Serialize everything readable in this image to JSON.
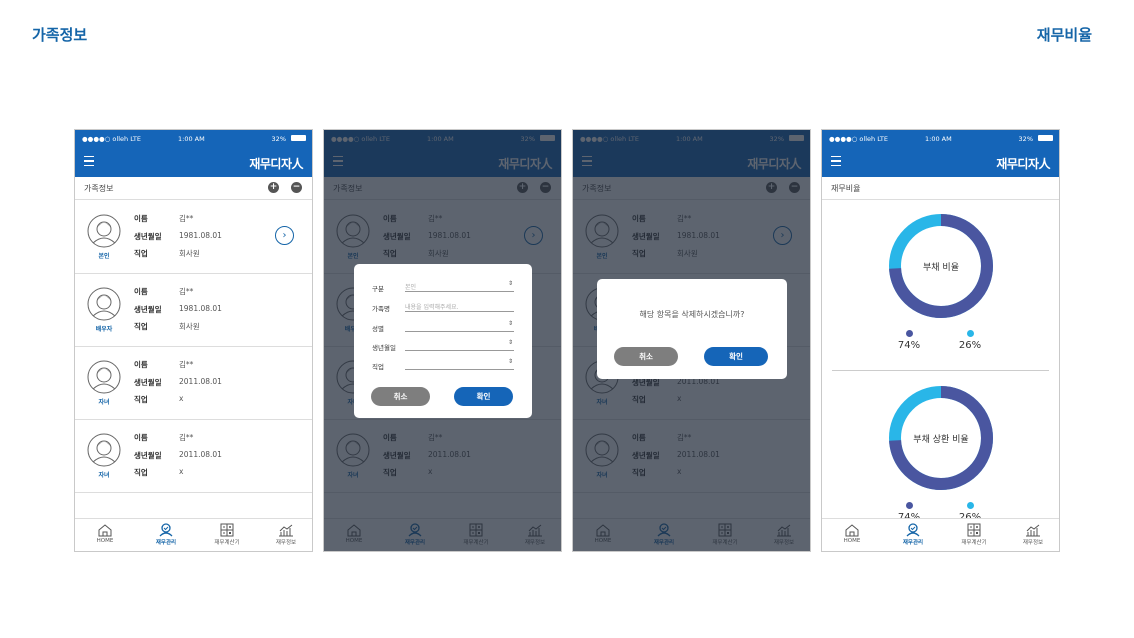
{
  "page": {
    "title_left": "가족정보",
    "title_right": "재무비율"
  },
  "status_bar": {
    "carrier": "●●●●○ olleh LTE",
    "time": "1:00 AM",
    "battery": "32%"
  },
  "app": {
    "logo": "재무디자人",
    "menu_icon": "hamburger-menu-icon"
  },
  "family_screen": {
    "header_label": "가족정보",
    "add_icon": "+",
    "remove_icon": "−",
    "field_labels": {
      "name": "이름",
      "birth": "생년월일",
      "job": "직업"
    },
    "members": [
      {
        "role": "본인",
        "name": "김**",
        "birth": "1981.08.01",
        "job": "회사원",
        "has_detail": true
      },
      {
        "role": "배우자",
        "name": "김**",
        "birth": "1981.08.01",
        "job": "회사원"
      },
      {
        "role": "자녀",
        "name": "김**",
        "birth": "2011.08.01",
        "job": "x"
      },
      {
        "role": "자녀",
        "name": "김**",
        "birth": "2011.08.01",
        "job": "x"
      }
    ],
    "detail_icon": "›"
  },
  "tabs": [
    {
      "label": "HOME",
      "icon": "home-icon"
    },
    {
      "label": "재무관리",
      "icon": "finance-manage-icon",
      "active": true
    },
    {
      "label": "재무계산기",
      "icon": "calculator-icon"
    },
    {
      "label": "재무정보",
      "icon": "finance-info-icon"
    }
  ],
  "form_dialog": {
    "fields": [
      {
        "label": "구분",
        "value": "본인",
        "select": true
      },
      {
        "label": "가족명",
        "placeholder": "내용을 입력해주세요.",
        "select": false
      },
      {
        "label": "성별",
        "value": "",
        "select": true
      },
      {
        "label": "생년월일",
        "value": "",
        "select": true
      },
      {
        "label": "직업",
        "value": "",
        "select": true
      }
    ],
    "cancel_label": "취소",
    "ok_label": "확인",
    "select_icon": "⇕"
  },
  "confirm_dialog": {
    "message": "해당 항목을 삭제하시겠습니까?",
    "cancel_label": "취소",
    "ok_label": "확인"
  },
  "ratio_screen": {
    "header_label": "재무비율",
    "charts": [
      {
        "title": "부채 비율",
        "slices": [
          74,
          26
        ],
        "labels": [
          "74%",
          "26%"
        ]
      },
      {
        "title": "부채 상환 비율",
        "slices": [
          74,
          26
        ],
        "labels": [
          "74%",
          "26%"
        ]
      }
    ],
    "colors": {
      "primary": "#4a56a0",
      "secondary": "#29b6e8"
    }
  },
  "colors": {
    "brand": "#1565b8",
    "accent_text": "#1565a8",
    "button_gray": "#7e7e7e"
  }
}
